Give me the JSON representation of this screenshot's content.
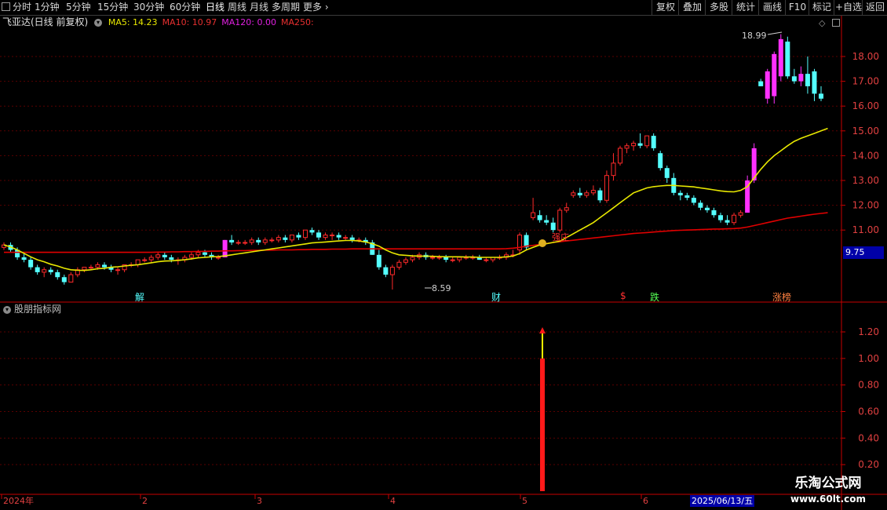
{
  "toolbar": {
    "periods": [
      "分时",
      "1分钟",
      "5分钟",
      "15分钟",
      "30分钟",
      "60分钟",
      "日线",
      "周线",
      "月线",
      "多周期",
      "更多"
    ],
    "active": "日线",
    "right": [
      "复权",
      "叠加",
      "多股",
      "统计",
      "画线",
      "F10",
      "标记",
      "+自选",
      "返回"
    ]
  },
  "info": {
    "title": "飞亚达(日线 前复权)",
    "ma": [
      {
        "label": "MA5: 14.23",
        "color": "#e8e800"
      },
      {
        "label": "MA10: 10.97",
        "color": "#e83030"
      },
      {
        "label": "MA120: 0.00",
        "color": "#e020e0"
      },
      {
        "label": "MA250:",
        "color": "#e83030"
      }
    ]
  },
  "indicator_panel": {
    "title": "股朋指标网"
  },
  "colors": {
    "up": "#ff2a2a",
    "down": "#54ffff",
    "ma_yellow": "#e8e800",
    "ma_red": "#e00000",
    "axis": "#c80000",
    "magenta": "#ff30ff",
    "bg": "#000000"
  },
  "last_price": "9.75",
  "date_box": "2025/06/13/五",
  "watermark": {
    "line1": "乐淘公式网",
    "line2": "www.60lt.com"
  },
  "annotations": {
    "high": "18.99",
    "low": "8.59",
    "marks": [
      {
        "text": "解",
        "color": "#54ffff"
      },
      {
        "text": "财",
        "color": "#54ffff"
      },
      {
        "text": "$",
        "color": "#ff3030"
      },
      {
        "text": "跌",
        "color": "#54ff54"
      },
      {
        "text": "涨榜",
        "color": "#ff8040"
      }
    ],
    "strong": "强庄"
  },
  "chart_data": [
    {
      "type": "candlestick",
      "y_ticks": [
        "18.00",
        "17.00",
        "16.00",
        "15.00",
        "14.00",
        "13.00",
        "12.00",
        "11.00"
      ],
      "ylim": [
        8.5,
        19.5
      ],
      "x_ticks": [
        "2024年",
        "2",
        "3",
        "4",
        "5",
        "6"
      ],
      "candles": [
        [
          10.3,
          10.5,
          10.2,
          10.4
        ],
        [
          10.4,
          10.5,
          10.1,
          10.2
        ],
        [
          10.2,
          10.3,
          9.8,
          9.9
        ],
        [
          9.9,
          10.1,
          9.7,
          9.8
        ],
        [
          9.8,
          9.9,
          9.4,
          9.5
        ],
        [
          9.5,
          9.6,
          9.2,
          9.3
        ],
        [
          9.3,
          9.5,
          9.1,
          9.4
        ],
        [
          9.4,
          9.5,
          9.2,
          9.3
        ],
        [
          9.3,
          9.4,
          9.0,
          9.1
        ],
        [
          9.1,
          9.2,
          8.8,
          8.9
        ],
        [
          8.9,
          9.3,
          8.9,
          9.2
        ],
        [
          9.2,
          9.5,
          9.1,
          9.4
        ],
        [
          9.4,
          9.5,
          9.3,
          9.5
        ],
        [
          9.5,
          9.6,
          9.4,
          9.5
        ],
        [
          9.5,
          9.7,
          9.4,
          9.6
        ],
        [
          9.6,
          9.7,
          9.4,
          9.5
        ],
        [
          9.5,
          9.6,
          9.3,
          9.4
        ],
        [
          9.4,
          9.5,
          9.2,
          9.4
        ],
        [
          9.4,
          9.6,
          9.3,
          9.6
        ],
        [
          9.6,
          9.7,
          9.5,
          9.6
        ],
        [
          9.6,
          9.8,
          9.5,
          9.8
        ],
        [
          9.8,
          9.9,
          9.7,
          9.8
        ],
        [
          9.8,
          10.0,
          9.7,
          9.9
        ],
        [
          9.9,
          10.1,
          9.8,
          10.0
        ],
        [
          10.0,
          10.1,
          9.8,
          9.9
        ],
        [
          9.9,
          10.0,
          9.7,
          9.8
        ],
        [
          9.8,
          9.9,
          9.6,
          9.8
        ],
        [
          9.8,
          10.0,
          9.7,
          9.9
        ],
        [
          9.9,
          10.1,
          9.8,
          10.0
        ],
        [
          10.0,
          10.2,
          9.9,
          10.1
        ],
        [
          10.1,
          10.2,
          9.9,
          10.0
        ],
        [
          10.0,
          10.1,
          9.8,
          9.9
        ],
        [
          9.9,
          10.0,
          9.8,
          9.9
        ],
        [
          9.9,
          10.6,
          9.9,
          10.6
        ],
        [
          10.6,
          10.8,
          10.4,
          10.5
        ],
        [
          10.5,
          10.6,
          10.4,
          10.5
        ],
        [
          10.5,
          10.6,
          10.4,
          10.5
        ],
        [
          10.5,
          10.7,
          10.4,
          10.6
        ],
        [
          10.6,
          10.7,
          10.4,
          10.5
        ],
        [
          10.5,
          10.7,
          10.4,
          10.6
        ],
        [
          10.6,
          10.7,
          10.5,
          10.6
        ],
        [
          10.6,
          10.8,
          10.5,
          10.7
        ],
        [
          10.7,
          10.8,
          10.5,
          10.6
        ],
        [
          10.6,
          10.8,
          10.5,
          10.8
        ],
        [
          10.8,
          10.9,
          10.6,
          10.7
        ],
        [
          10.7,
          11.0,
          10.6,
          11.0
        ],
        [
          11.0,
          11.1,
          10.8,
          10.9
        ],
        [
          10.9,
          11.0,
          10.6,
          10.7
        ],
        [
          10.7,
          10.9,
          10.6,
          10.8
        ],
        [
          10.8,
          10.9,
          10.6,
          10.8
        ],
        [
          10.8,
          10.9,
          10.6,
          10.7
        ],
        [
          10.7,
          10.8,
          10.6,
          10.7
        ],
        [
          10.7,
          10.8,
          10.5,
          10.6
        ],
        [
          10.6,
          10.7,
          10.5,
          10.6
        ],
        [
          10.6,
          10.7,
          10.4,
          10.5
        ],
        [
          10.5,
          10.6,
          10.0,
          10.0
        ],
        [
          10.0,
          10.2,
          9.4,
          9.5
        ],
        [
          9.5,
          9.6,
          9.1,
          9.2
        ],
        [
          9.2,
          9.6,
          8.6,
          9.5
        ],
        [
          9.5,
          9.8,
          9.4,
          9.7
        ],
        [
          9.7,
          9.9,
          9.6,
          9.8
        ],
        [
          9.8,
          10.0,
          9.7,
          9.9
        ],
        [
          9.9,
          10.1,
          9.8,
          10.0
        ],
        [
          10.0,
          10.1,
          9.8,
          9.9
        ],
        [
          9.9,
          10.0,
          9.8,
          9.9
        ],
        [
          9.9,
          10.0,
          9.8,
          9.9
        ],
        [
          9.9,
          10.0,
          9.7,
          9.8
        ],
        [
          9.8,
          9.9,
          9.7,
          9.8
        ],
        [
          9.8,
          9.9,
          9.7,
          9.9
        ],
        [
          9.9,
          10.0,
          9.8,
          9.9
        ],
        [
          9.9,
          10.0,
          9.8,
          9.9
        ],
        [
          9.9,
          10.0,
          9.8,
          9.8
        ],
        [
          9.8,
          9.9,
          9.7,
          9.8
        ],
        [
          9.8,
          9.9,
          9.7,
          9.9
        ],
        [
          9.9,
          10.0,
          9.8,
          9.9
        ],
        [
          9.9,
          10.1,
          9.8,
          10.0
        ],
        [
          10.0,
          10.2,
          9.9,
          10.0
        ],
        [
          10.2,
          10.9,
          10.0,
          10.8
        ],
        [
          10.8,
          10.9,
          10.2,
          10.3
        ],
        [
          11.5,
          12.3,
          11.4,
          11.7
        ],
        [
          11.6,
          11.8,
          11.3,
          11.4
        ],
        [
          11.4,
          11.6,
          11.2,
          11.3
        ],
        [
          11.3,
          11.5,
          10.9,
          11.0
        ],
        [
          11.0,
          11.9,
          10.9,
          11.8
        ],
        [
          11.8,
          12.1,
          11.7,
          11.9
        ],
        [
          12.4,
          12.6,
          12.3,
          12.5
        ],
        [
          12.5,
          12.7,
          12.3,
          12.4
        ],
        [
          12.4,
          12.6,
          12.3,
          12.5
        ],
        [
          12.5,
          12.8,
          12.4,
          12.6
        ],
        [
          12.6,
          12.7,
          12.1,
          12.2
        ],
        [
          12.2,
          13.4,
          12.1,
          13.2
        ],
        [
          13.2,
          14.1,
          13.0,
          13.7
        ],
        [
          13.7,
          14.4,
          13.6,
          14.3
        ],
        [
          14.3,
          14.5,
          14.1,
          14.4
        ],
        [
          14.4,
          14.6,
          14.2,
          14.5
        ],
        [
          14.5,
          14.9,
          14.3,
          14.4
        ],
        [
          14.4,
          14.8,
          14.3,
          14.8
        ],
        [
          14.8,
          14.9,
          14.2,
          14.3
        ],
        [
          14.1,
          14.2,
          13.4,
          13.5
        ],
        [
          13.5,
          13.6,
          12.9,
          13.1
        ],
        [
          13.1,
          13.3,
          12.4,
          12.5
        ],
        [
          12.5,
          12.6,
          12.2,
          12.4
        ],
        [
          12.4,
          12.5,
          12.2,
          12.3
        ],
        [
          12.3,
          12.4,
          12.0,
          12.1
        ],
        [
          12.1,
          12.2,
          11.8,
          11.9
        ],
        [
          11.9,
          12.0,
          11.7,
          11.8
        ],
        [
          11.8,
          11.9,
          11.5,
          11.6
        ],
        [
          11.6,
          11.7,
          11.3,
          11.4
        ],
        [
          11.4,
          11.6,
          11.2,
          11.3
        ],
        [
          11.3,
          11.7,
          11.2,
          11.6
        ],
        [
          11.6,
          11.8,
          11.5,
          11.7
        ],
        [
          11.7,
          13.2,
          11.7,
          13.0
        ],
        [
          13.0,
          14.5,
          12.9,
          14.3
        ],
        [
          17.0,
          17.1,
          16.8,
          16.8
        ],
        [
          16.3,
          17.5,
          16.1,
          17.4
        ],
        [
          16.4,
          18.2,
          16.1,
          18.1
        ],
        [
          17.2,
          18.9,
          17.0,
          18.7
        ],
        [
          18.6,
          18.8,
          17.1,
          17.2
        ],
        [
          17.2,
          17.5,
          16.9,
          17.0
        ],
        [
          17.0,
          17.6,
          16.8,
          17.3
        ],
        [
          17.3,
          18.0,
          16.5,
          16.8
        ],
        [
          17.4,
          17.5,
          16.2,
          16.5
        ],
        [
          16.5,
          16.8,
          16.2,
          16.3
        ]
      ],
      "ma_yellow": [
        10.4,
        10.32,
        10.2,
        10.06,
        9.92,
        9.8,
        9.72,
        9.62,
        9.55,
        9.46,
        9.4,
        9.38,
        9.37,
        9.4,
        9.44,
        9.46,
        9.5,
        9.52,
        9.55,
        9.58,
        9.6,
        9.64,
        9.68,
        9.72,
        9.75,
        9.76,
        9.78,
        9.8,
        9.84,
        9.88,
        9.9,
        9.92,
        9.93,
        9.96,
        10.0,
        10.04,
        10.08,
        10.12,
        10.16,
        10.2,
        10.24,
        10.28,
        10.32,
        10.36,
        10.4,
        10.44,
        10.48,
        10.5,
        10.52,
        10.54,
        10.56,
        10.58,
        10.58,
        10.56,
        10.52,
        10.45,
        10.35,
        10.2,
        10.08,
        10.0,
        9.98,
        9.96,
        9.95,
        9.95,
        9.94,
        9.93,
        9.92,
        9.92,
        9.92,
        9.91,
        9.91,
        9.9,
        9.9,
        9.9,
        9.9,
        9.92,
        9.95,
        10.05,
        10.2,
        10.3,
        10.4,
        10.45,
        10.5,
        10.55,
        10.7,
        10.85,
        11.0,
        11.15,
        11.3,
        11.5,
        11.7,
        11.9,
        12.1,
        12.3,
        12.5,
        12.6,
        12.7,
        12.75,
        12.78,
        12.8,
        12.8,
        12.78,
        12.76,
        12.74,
        12.7,
        12.66,
        12.62,
        12.58,
        12.55,
        12.54,
        12.6,
        12.75,
        13.1,
        13.45,
        13.75,
        14.0,
        14.2,
        14.4,
        14.58,
        14.7,
        14.8,
        14.9,
        15.0,
        15.1
      ],
      "ma_red": [
        10.1,
        10.1,
        10.1,
        10.1,
        10.1,
        10.1,
        10.1,
        10.1,
        10.1,
        10.1,
        10.1,
        10.1,
        10.1,
        10.1,
        10.1,
        10.1,
        10.1,
        10.1,
        10.1,
        10.1,
        10.1,
        10.1,
        10.1,
        10.11,
        10.11,
        10.12,
        10.12,
        10.13,
        10.13,
        10.14,
        10.14,
        10.15,
        10.15,
        10.16,
        10.16,
        10.17,
        10.17,
        10.18,
        10.18,
        10.19,
        10.19,
        10.2,
        10.2,
        10.2,
        10.21,
        10.21,
        10.22,
        10.22,
        10.22,
        10.23,
        10.23,
        10.23,
        10.24,
        10.24,
        10.24,
        10.24,
        10.24,
        10.24,
        10.24,
        10.24,
        10.24,
        10.24,
        10.24,
        10.24,
        10.24,
        10.24,
        10.24,
        10.24,
        10.24,
        10.24,
        10.24,
        10.24,
        10.24,
        10.24,
        10.24,
        10.25,
        10.27,
        10.3,
        10.35,
        10.38,
        10.42,
        10.46,
        10.5,
        10.53,
        10.56,
        10.59,
        10.62,
        10.65,
        10.68,
        10.71,
        10.74,
        10.77,
        10.8,
        10.83,
        10.86,
        10.88,
        10.9,
        10.92,
        10.94,
        10.96,
        10.98,
        10.99,
        11.0,
        11.01,
        11.02,
        11.03,
        11.04,
        11.04,
        11.05,
        11.06,
        11.08,
        11.12,
        11.18,
        11.24,
        11.3,
        11.36,
        11.42,
        11.48,
        11.52,
        11.56,
        11.6,
        11.64,
        11.67,
        11.7
      ]
    },
    {
      "type": "bar",
      "y_ticks": [
        "1.20",
        "1.00",
        "0.80",
        "0.60",
        "0.40",
        "0.20"
      ],
      "ylim": [
        0,
        1.3
      ],
      "signal_value": 1.0,
      "arrow_top": 1.2
    }
  ]
}
